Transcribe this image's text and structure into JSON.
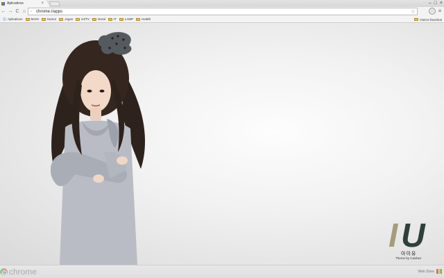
{
  "tab": {
    "title": "Aplicativos",
    "close": "×"
  },
  "window": {
    "minimize": "–",
    "maximize": "□",
    "close": "×"
  },
  "toolbar": {
    "back": "←",
    "forward": "→",
    "reload": "C",
    "home": "⌂",
    "url": "chrome://apps",
    "star": "☆",
    "menu": "≡"
  },
  "bookmarks": {
    "apps_label": "Aplicativos",
    "items": [
      "MAIN",
      "Humor",
      "Jogos",
      "KZTV",
      "Geral",
      "IT",
      "LAMP",
      "Health"
    ],
    "other": "Outros favoritos"
  },
  "theme": {
    "logo_i": "I",
    "logo_u": "U",
    "korean": "아이유",
    "credit": "Theme by Caixbez",
    "colors": {
      "logo_i": "#a59c7a",
      "logo_u": "#2e4038"
    }
  },
  "bottom": {
    "brand": "chrome",
    "webstore": "Web Store"
  },
  "icons": {
    "favicon": "apps-grid-icon",
    "folder": "folder-icon",
    "ext1": "extension-icon",
    "ext2": "info-icon"
  }
}
